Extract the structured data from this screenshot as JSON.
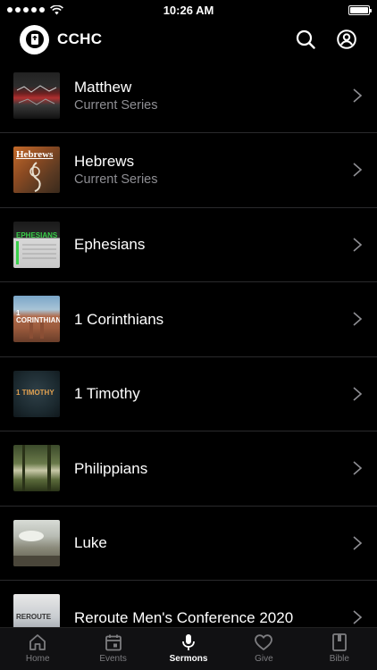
{
  "status_bar": {
    "time": "10:26 AM"
  },
  "header": {
    "title": "CCHC"
  },
  "series": [
    {
      "title": "Matthew",
      "subtitle": "Current Series",
      "thumb_text": ""
    },
    {
      "title": "Hebrews",
      "subtitle": "Current Series",
      "thumb_text": "Hebrews"
    },
    {
      "title": "Ephesians",
      "subtitle": "",
      "thumb_text": "EPHESIANS"
    },
    {
      "title": "1 Corinthians",
      "subtitle": "",
      "thumb_text": "1 CORINTHIANS"
    },
    {
      "title": "1 Timothy",
      "subtitle": "",
      "thumb_text": "1 TIMOTHY"
    },
    {
      "title": "Philippians",
      "subtitle": "",
      "thumb_text": ""
    },
    {
      "title": "Luke",
      "subtitle": "",
      "thumb_text": ""
    },
    {
      "title": "Reroute Men's Conference 2020",
      "subtitle": "",
      "thumb_text": "REROUTE"
    }
  ],
  "tabs": [
    {
      "label": "Home",
      "icon": "home-icon"
    },
    {
      "label": "Events",
      "icon": "calendar-icon"
    },
    {
      "label": "Sermons",
      "icon": "microphone-icon",
      "active": true
    },
    {
      "label": "Give",
      "icon": "heart-icon"
    },
    {
      "label": "Bible",
      "icon": "book-icon"
    }
  ],
  "colors": {
    "background": "#000000",
    "divider": "#2a2a2c",
    "subtitle": "#8e8e93",
    "tab_inactive": "#7d7d80"
  }
}
